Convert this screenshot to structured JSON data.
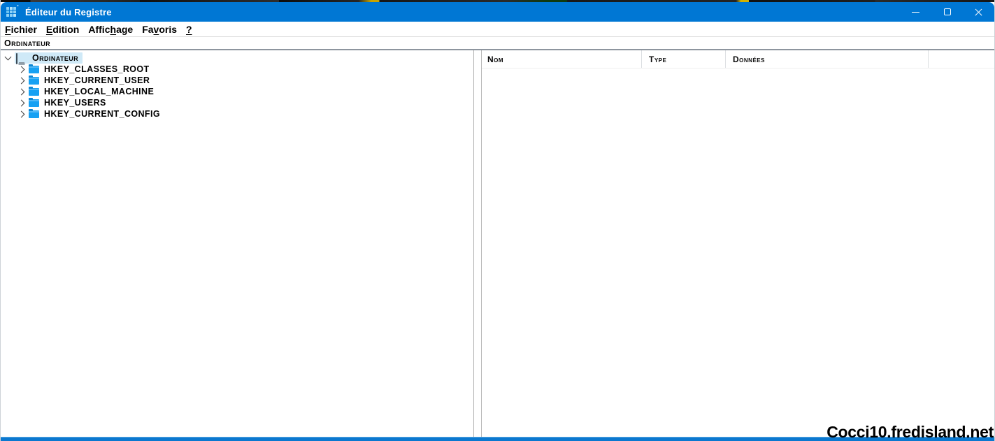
{
  "window": {
    "title": "Éditeur du Registre",
    "icons": [
      "registry-editor-icon",
      "minimize-icon",
      "maximize-icon",
      "close-icon"
    ]
  },
  "menu": {
    "items": [
      {
        "pre": "",
        "u": "F",
        "post": "ichier"
      },
      {
        "pre": "",
        "u": "E",
        "post": "dition"
      },
      {
        "pre": "Affic",
        "u": "h",
        "post": "age"
      },
      {
        "pre": "Fa",
        "u": "v",
        "post": "oris"
      },
      {
        "pre": "",
        "u": "?",
        "post": ""
      }
    ]
  },
  "address_bar": {
    "value": "Ordinateur"
  },
  "tree": {
    "root": {
      "label": "Ordinateur",
      "selected": true,
      "expanded": true,
      "icon": "computer-icon"
    },
    "children": [
      {
        "label": "HKEY_CLASSES_ROOT",
        "icon": "folder-icon"
      },
      {
        "label": "HKEY_CURRENT_USER",
        "icon": "folder-icon"
      },
      {
        "label": "HKEY_LOCAL_MACHINE",
        "icon": "folder-icon"
      },
      {
        "label": "HKEY_USERS",
        "icon": "folder-icon"
      },
      {
        "label": "HKEY_CURRENT_CONFIG",
        "icon": "folder-icon"
      }
    ]
  },
  "list": {
    "columns": [
      "Nom",
      "Type",
      "Données"
    ],
    "rows": []
  },
  "watermark": "Cocci10.fredisland.net",
  "colors": {
    "titlebar": "#0077d4",
    "selection": "#cfe9f7",
    "folder": "#17a1f3",
    "bottom_border": "#0b78cf"
  }
}
